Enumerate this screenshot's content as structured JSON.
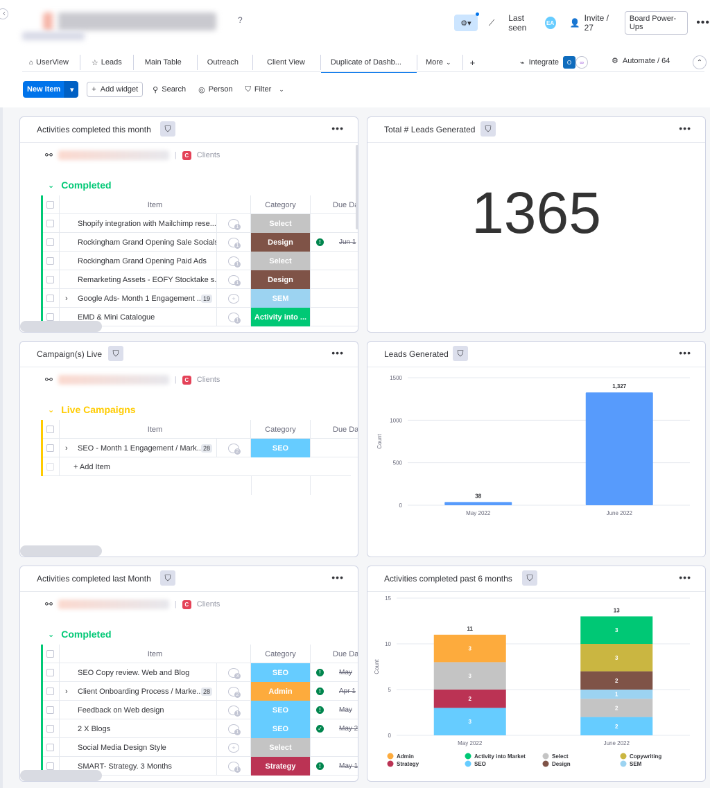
{
  "header": {
    "board_name": "Hidden Home & Living",
    "help_mark": "?",
    "last_seen_label": "Last seen",
    "last_seen_avatar": "EA",
    "invite_label": "Invite / 27",
    "power_ups_label": "Board Power-Ups"
  },
  "tabs": [
    {
      "label": "UserView",
      "icon": "home-icon"
    },
    {
      "label": "Leads",
      "icon": "star-icon"
    },
    {
      "label": "Main Table"
    },
    {
      "label": "Outreach"
    },
    {
      "label": "Client View"
    },
    {
      "label": "Duplicate of Dashb..."
    },
    {
      "label": "More"
    }
  ],
  "tab_add": "+",
  "integrate_label": "Integrate",
  "automate_label": "Automate / 64",
  "toolbar": {
    "new_item": "New Item",
    "add_widget": "Add widget",
    "search": "Search",
    "person": "Person",
    "filter": "Filter"
  },
  "colors": {
    "select": "#c4c4c4",
    "design": "#7f5347",
    "sem": "#9cd3f1",
    "activity": "#00c875",
    "seo": "#66ccff",
    "admin": "#fdab3d",
    "strategy": "#bb3354",
    "copywriting": "#cab641",
    "completed": "#00c875",
    "live": "#ffcb00",
    "bar": "#579bfc"
  },
  "w1": {
    "title": "Activities completed this month",
    "board_label": "Clients",
    "group": "Completed",
    "col_item": "Item",
    "col_category": "Category",
    "col_due": "Due Da",
    "rows": [
      {
        "item": "Shopify integration with Mailchimp rese...",
        "upd": "1",
        "cat": "Select",
        "due": "",
        "alert": false
      },
      {
        "item": "Rockingham Grand Opening Sale Socials",
        "upd": "1",
        "cat": "Design",
        "due": "Jun 1",
        "alert": true
      },
      {
        "item": "Rockingham Grand Opening Paid Ads",
        "upd": "1",
        "cat": "Select",
        "due": "",
        "alert": false
      },
      {
        "item": "Remarketing Assets - EOFY Stocktake s...",
        "upd": "1",
        "cat": "Design",
        "due": "",
        "alert": false
      },
      {
        "item": "Google Ads- Month 1 Engagement ...",
        "count": "19",
        "upd": "",
        "cat": "SEM",
        "due": "",
        "alert": false,
        "expand": true
      },
      {
        "item": "EMD & Mini Catalogue",
        "upd": "1",
        "cat": "Activity into ...",
        "due": "",
        "alert": false
      }
    ]
  },
  "w2": {
    "title": "Total # Leads Generated",
    "value": "1365"
  },
  "w3": {
    "title": "Campaign(s) Live",
    "board_label": "Clients",
    "group": "Live Campaigns",
    "col_item": "Item",
    "col_category": "Category",
    "col_due": "Due Da",
    "rows": [
      {
        "item": "SEO - Month 1 Engagement / Mark...",
        "count": "28",
        "upd": "2",
        "cat": "SEO",
        "expand": true
      }
    ],
    "add_item": "+ Add Item"
  },
  "w4": {
    "title": "Leads Generated",
    "chart_data": {
      "type": "bar",
      "categories": [
        "May 2022",
        "June 2022"
      ],
      "values": [
        38,
        1327
      ],
      "data_labels": [
        "38",
        "1,327"
      ],
      "ylabel": "Count",
      "ylim": [
        0,
        1500
      ],
      "yticks": [
        0,
        500,
        1000,
        1500
      ],
      "grid": true
    }
  },
  "w5": {
    "title": "Activities completed last Month",
    "board_label": "Clients",
    "group": "Completed",
    "col_item": "Item",
    "col_category": "Category",
    "col_due": "Due Da",
    "rows": [
      {
        "item": "SEO Copy review. Web and Blog",
        "upd": "3",
        "cat": "SEO",
        "due": "May",
        "icon": "alert"
      },
      {
        "item": "Client Onboarding Process / Marke...",
        "count": "28",
        "upd": "2",
        "cat": "Admin",
        "due": "Apr 1",
        "icon": "alert",
        "expand": true
      },
      {
        "item": "Feedback on Web design",
        "upd": "1",
        "cat": "SEO",
        "due": "May",
        "icon": "alert"
      },
      {
        "item": "2 X Blogs",
        "upd": "1",
        "cat": "SEO",
        "due": "May 2",
        "icon": "check"
      },
      {
        "item": "Social Media Design Style",
        "upd": "",
        "cat": "Select",
        "due": "",
        "icon": ""
      },
      {
        "item": "SMART- Strategy. 3 Months",
        "upd": "1",
        "cat": "Strategy",
        "due": "May 1",
        "icon": "alert"
      }
    ]
  },
  "w6": {
    "title": "Activities completed past 6 months",
    "chart_data": {
      "type": "bar",
      "stacked": true,
      "categories": [
        "May 2022",
        "June 2022"
      ],
      "ylabel": "Count",
      "ylim": [
        0,
        15
      ],
      "yticks": [
        0,
        5,
        10,
        15
      ],
      "totals": [
        11,
        13
      ],
      "series": [
        {
          "name": "SEO",
          "color": "#66ccff",
          "values": [
            3,
            2
          ]
        },
        {
          "name": "Strategy",
          "color": "#bb3354",
          "values": [
            2,
            0
          ]
        },
        {
          "name": "Select",
          "color": "#c4c4c4",
          "values": [
            3,
            2
          ]
        },
        {
          "name": "Admin",
          "color": "#fdab3d",
          "values": [
            3,
            0
          ]
        },
        {
          "name": "SEM",
          "color": "#9cd3f1",
          "values": [
            0,
            1
          ]
        },
        {
          "name": "Design",
          "color": "#7f5347",
          "values": [
            0,
            2
          ]
        },
        {
          "name": "Copywriting",
          "color": "#cab641",
          "values": [
            0,
            3
          ]
        },
        {
          "name": "Activity into Market",
          "color": "#00c875",
          "values": [
            0,
            3
          ]
        }
      ],
      "legend": [
        [
          "Admin",
          "Activity into Market",
          "Select",
          "Copywriting"
        ],
        [
          "Strategy",
          "SEO",
          "Design",
          "SEM"
        ]
      ],
      "legend_position": "bottom"
    }
  }
}
